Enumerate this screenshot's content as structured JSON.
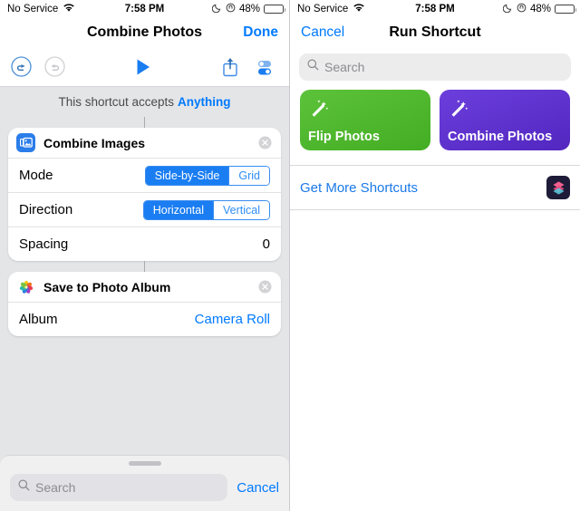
{
  "status_bar": {
    "carrier": "No Service",
    "wifi_icon": "wifi-icon",
    "time": "7:58 PM",
    "dnd_icon": "moon-icon",
    "lock_rotation_icon": "rotation-lock-icon",
    "battery_percent": "48%",
    "battery_level": 48
  },
  "left_panel": {
    "nav": {
      "title": "Combine Photos",
      "done_label": "Done"
    },
    "toolbar": {
      "undo_icon": "undo-icon",
      "redo_icon": "redo-icon",
      "run_icon": "play-icon",
      "share_icon": "share-icon",
      "settings_icon": "toggles-icon"
    },
    "accepts_banner": {
      "prefix": "This shortcut accepts",
      "type": "Anything"
    },
    "actions": [
      {
        "icon": "combine-images-icon",
        "title": "Combine Images",
        "close_icon": "close-icon",
        "rows": [
          {
            "label": "Mode",
            "kind": "segmented",
            "options": [
              "Side-by-Side",
              "Grid"
            ],
            "selected": "Side-by-Side"
          },
          {
            "label": "Direction",
            "kind": "segmented",
            "options": [
              "Horizontal",
              "Vertical"
            ],
            "selected": "Horizontal"
          },
          {
            "label": "Spacing",
            "kind": "value",
            "value": "0"
          }
        ]
      },
      {
        "icon": "photos-app-icon",
        "title": "Save to Photo Album",
        "close_icon": "close-icon",
        "rows": [
          {
            "label": "Album",
            "kind": "link",
            "value": "Camera Roll"
          }
        ]
      }
    ],
    "dock": {
      "grabber": "drag-handle",
      "search_icon": "search-icon",
      "search_placeholder": "Search",
      "search_value": "",
      "cancel_label": "Cancel"
    }
  },
  "right_panel": {
    "nav": {
      "cancel_label": "Cancel",
      "title": "Run Shortcut"
    },
    "search": {
      "icon": "search-icon",
      "placeholder": "Search",
      "value": ""
    },
    "tiles": [
      {
        "name": "Flip Photos",
        "color": "#4CB82C",
        "icon": "magic-wand-icon"
      },
      {
        "name": "Combine Photos",
        "color": "#5B2FCC",
        "icon": "magic-wand-icon"
      }
    ],
    "get_more": {
      "label": "Get More Shortcuts",
      "app_icon": "shortcuts-app-icon"
    }
  },
  "colors": {
    "accent_blue": "#007aff",
    "link_blue": "#1a79e8",
    "panel_bg": "#e4e5e7",
    "card_bg": "#ffffff",
    "tile_green": "#4CB82C",
    "tile_purple": "#5B2FCC"
  }
}
